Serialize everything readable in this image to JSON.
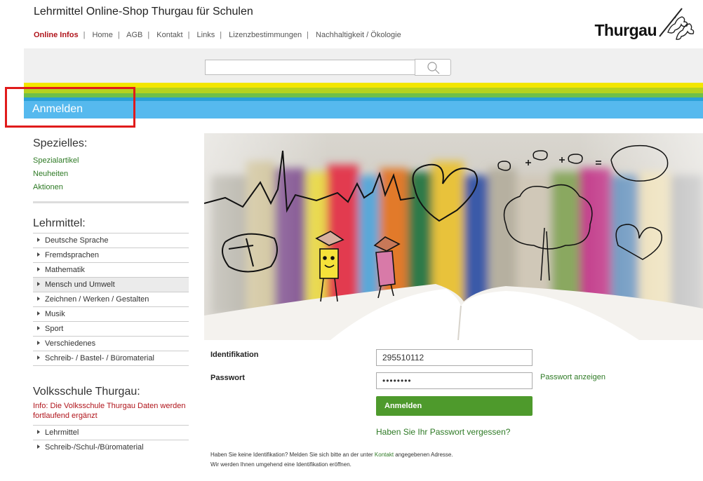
{
  "header": {
    "site_title": "Lehrmittel Online-Shop Thurgau für Schulen",
    "brand": "Thurgau",
    "nav": [
      "Online Infos",
      "Home",
      "AGB",
      "Kontakt",
      "Links",
      "Lizenzbestimmungen",
      "Nachhaltigkeit / Ökologie"
    ]
  },
  "search": {
    "value": ""
  },
  "login_bar": {
    "label": "Anmelden"
  },
  "sidebar": {
    "special_title": "Spezielles:",
    "special_links": [
      "Spezialartikel",
      "Neuheiten",
      "Aktionen"
    ],
    "lehrmittel_title": "Lehrmittel:",
    "lehrmittel_items": [
      "Deutsche Sprache",
      "Fremdsprachen",
      "Mathematik",
      "Mensch und Umwelt",
      "Zeichnen / Werken / Gestalten",
      "Musik",
      "Sport",
      "Verschiedenes",
      "Schreib- / Bastel- / Büromaterial"
    ],
    "volksschule_title": "Volksschule Thurgau:",
    "volksschule_info": "Info: Die Volksschule Thurgau Daten werden fortlaufend ergänzt",
    "volksschule_items": [
      "Lehrmittel",
      "Schreib-/Schul-/Büromaterial"
    ]
  },
  "login_form": {
    "id_label": "Identifikation",
    "id_value": "295510112",
    "pw_label": "Passwort",
    "pw_value": "••••••••",
    "show_pw": "Passwort anzeigen",
    "submit": "Anmelden",
    "forgot": "Haben Sie Ihr Passwort vergessen?",
    "note_1a": "Haben Sie keine Identifikation? Melden Sie sich bitte an der unter ",
    "note_link": "Kontakt",
    "note_1b": " angegebenen Adresse.",
    "note_2": "Wir werden Ihnen umgehend eine Identifikation eröffnen."
  },
  "colors": {
    "accent_red": "#b0141b",
    "link_green": "#2e7a25",
    "button_green": "#4e9a2c",
    "bar_blue": "#56b9ee",
    "stripe_yellow": "#f3e600",
    "stripe_lime": "#b6d21f",
    "stripe_green": "#6fbf4a",
    "highlight_red": "#e01b1b"
  },
  "icons": {
    "search": "search-icon",
    "brand": "thurgau-lions-logo"
  }
}
